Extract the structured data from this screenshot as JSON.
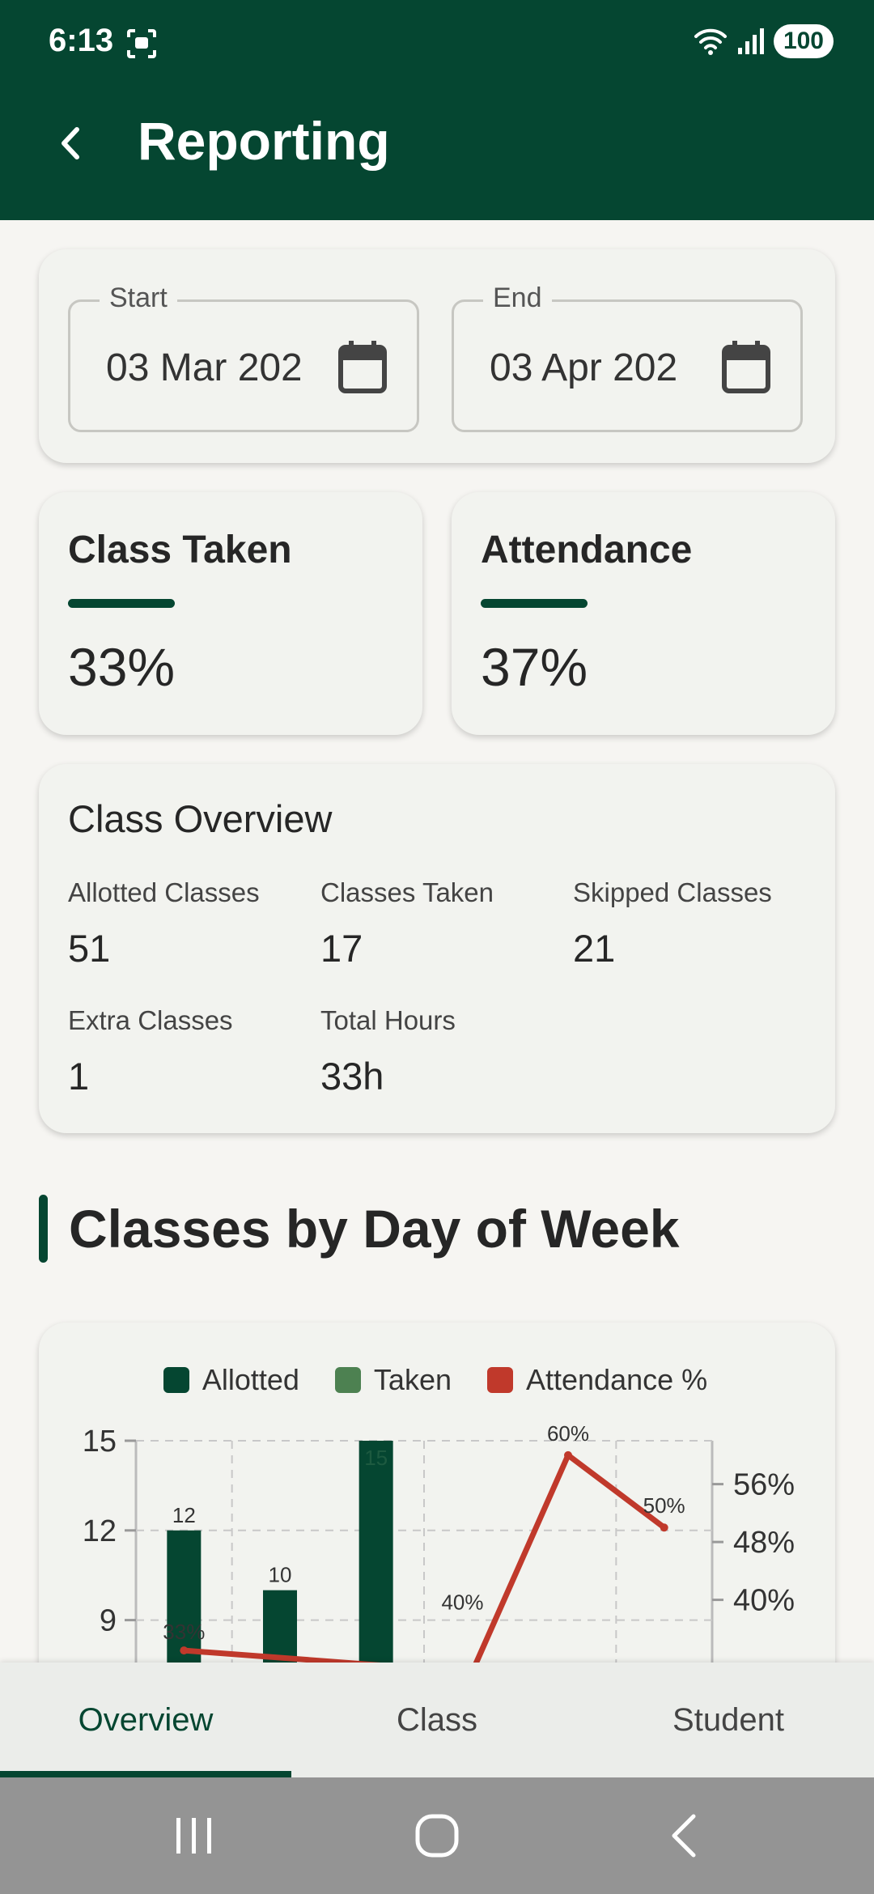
{
  "status": {
    "time": "6:13",
    "battery": "100"
  },
  "appbar": {
    "title": "Reporting"
  },
  "dates": {
    "start": {
      "label": "Start",
      "value": "03 Mar 202"
    },
    "end": {
      "label": "End",
      "value": "03 Apr 202"
    }
  },
  "stats": {
    "class_taken": {
      "title": "Class Taken",
      "value": "33%"
    },
    "attendance": {
      "title": "Attendance",
      "value": "37%"
    }
  },
  "overview": {
    "title": "Class Overview",
    "items": [
      {
        "label": "Allotted Classes",
        "value": "51"
      },
      {
        "label": "Classes Taken",
        "value": "17"
      },
      {
        "label": "Skipped Classes",
        "value": "21"
      },
      {
        "label": "Extra Classes",
        "value": "1"
      },
      {
        "label": "Total Hours",
        "value": "33h"
      }
    ]
  },
  "section": {
    "title": "Classes by Day of Week"
  },
  "chart_data": {
    "type": "bar",
    "legend": [
      "Allotted",
      "Taken",
      "Attendance %"
    ],
    "left_axis_ticks": [
      "15",
      "12",
      "9"
    ],
    "right_axis_ticks": [
      "56%",
      "48%",
      "40%"
    ],
    "ylim_left": [
      0,
      15
    ],
    "ylim_right": [
      0,
      62
    ],
    "series": [
      {
        "name": "Allotted",
        "type": "bar",
        "color": "#054631",
        "points": [
          [
            0,
            12
          ],
          [
            1,
            10
          ],
          [
            2,
            15
          ]
        ],
        "labels": [
          "12",
          "10",
          "15"
        ]
      },
      {
        "name": "Attendance %",
        "type": "line",
        "color": "#c0392b",
        "points": [
          [
            0,
            33
          ],
          [
            3,
            30
          ],
          [
            4,
            60
          ],
          [
            5,
            50
          ]
        ],
        "labels": [
          "33%",
          "40%",
          "60%",
          "50%"
        ]
      }
    ],
    "grid": true,
    "legend_position": "top"
  },
  "tabs": [
    "Overview",
    "Class",
    "Student"
  ],
  "colors": {
    "primary": "#054631",
    "taken": "#4d8151",
    "attendance": "#c0392b"
  }
}
